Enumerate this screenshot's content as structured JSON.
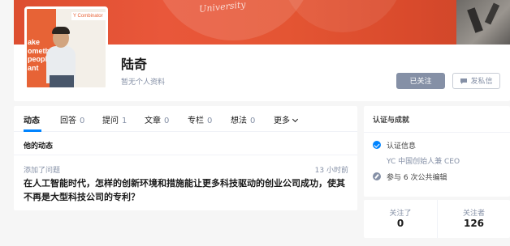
{
  "cover": {
    "text": "University"
  },
  "profile": {
    "avatar_poster": {
      "brand": "Y Combinator",
      "slogan_lines": [
        "ake",
        "omethin",
        "people",
        "ant"
      ]
    },
    "name": "陆奇",
    "bio": "暂无个人资料",
    "followed_button": "已关注",
    "message_button": "发私信"
  },
  "tabs": [
    {
      "label": "动态",
      "count": ""
    },
    {
      "label": "回答",
      "count": "0"
    },
    {
      "label": "提问",
      "count": "1"
    },
    {
      "label": "文章",
      "count": "0"
    },
    {
      "label": "专栏",
      "count": "0"
    },
    {
      "label": "想法",
      "count": "0"
    },
    {
      "label": "更多",
      "count": ""
    }
  ],
  "activity": {
    "heading": "他的动态",
    "items": [
      {
        "action": "添加了问题",
        "time": "13 小时前",
        "title": "在人工智能时代，怎样的创新环境和措施能让更多科技驱动的创业公司成功，使其不再是大型科技公司的专利？"
      }
    ]
  },
  "side": {
    "title": "认证与成就",
    "cert_label": "认证信息",
    "cert_detail": "YC 中国创始人兼 CEO",
    "edit_label": "参与 6 次公共编辑"
  },
  "stats": {
    "following_label": "关注了",
    "following_value": "0",
    "followers_label": "关注者",
    "followers_value": "126"
  },
  "colors": {
    "accent": "#0084ff",
    "muted": "#8590a6",
    "cover": "#e45533"
  }
}
